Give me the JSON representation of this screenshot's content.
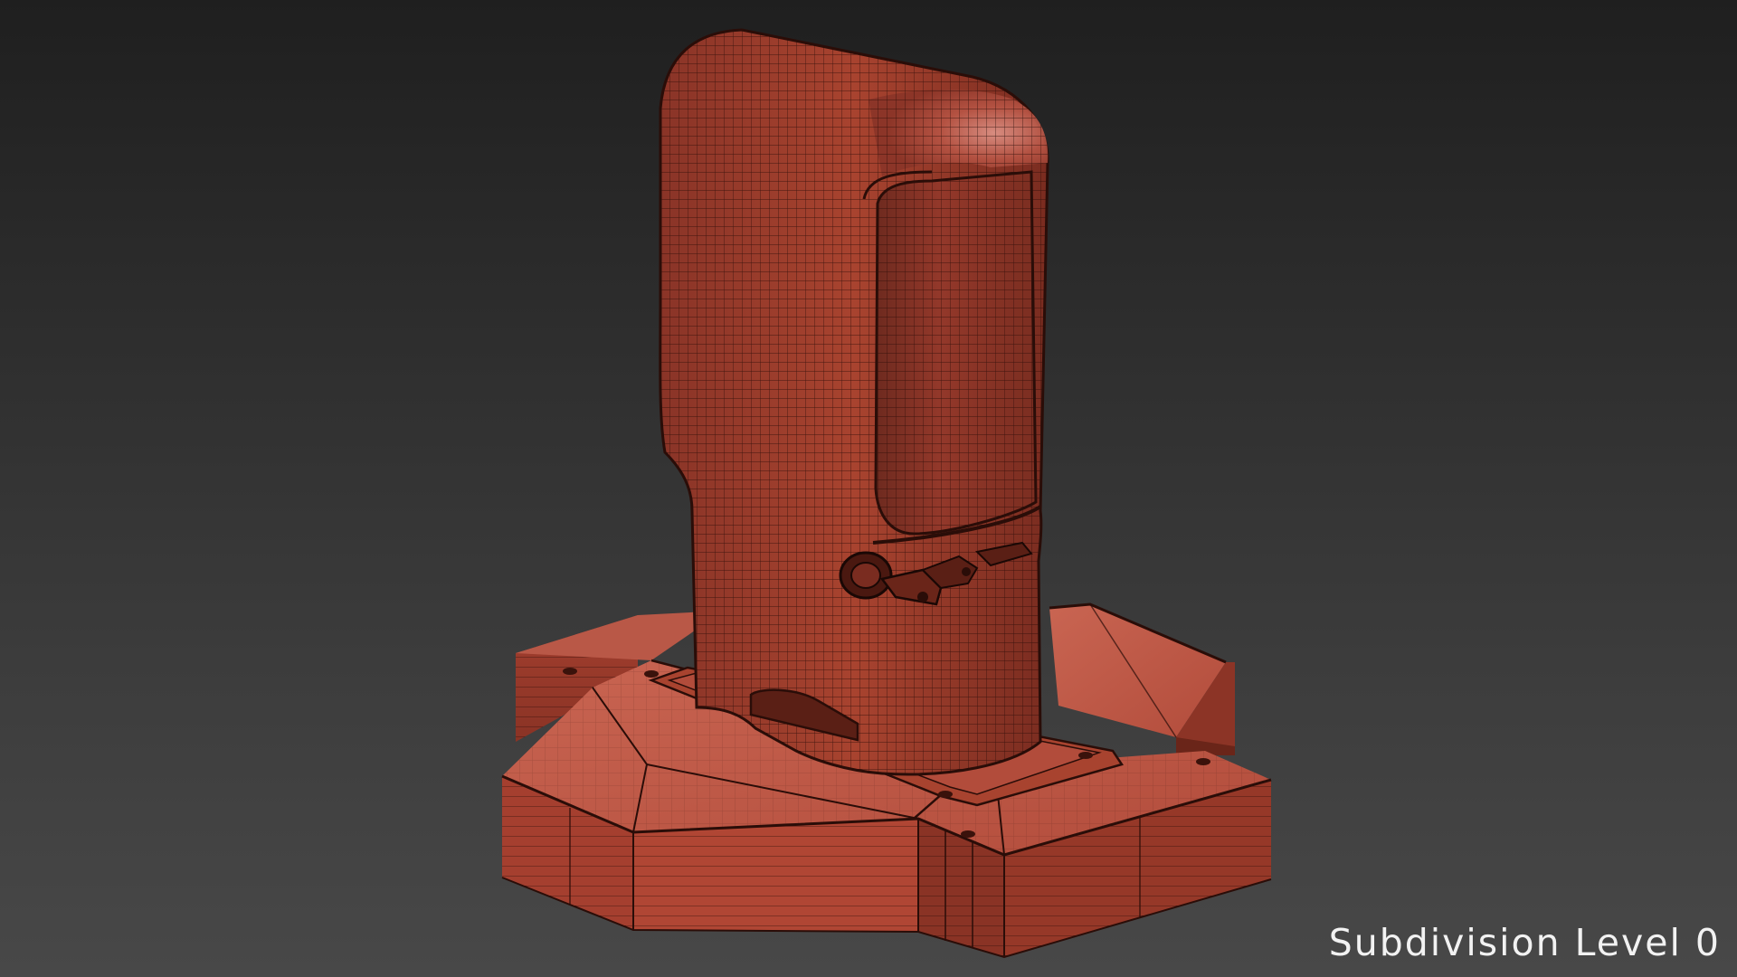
{
  "overlay": {
    "caption": "Subdivision Level 0"
  },
  "render": {
    "subject": "wireframe-3d-model",
    "colors": {
      "background_top": "#1f1f1f",
      "background_bottom": "#484848",
      "mesh_fill": "#b34a3a",
      "mesh_shadow": "#6e2a1f",
      "mesh_highlight": "#d77e70",
      "wire": "#2a0d08",
      "caption": "#f2f2f2"
    }
  }
}
